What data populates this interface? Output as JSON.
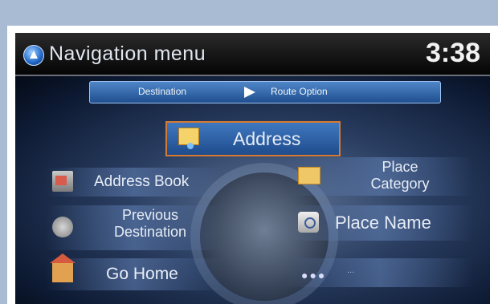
{
  "header": {
    "title": "Navigation menu",
    "clock": "3:38"
  },
  "tabs": {
    "destination": "Destination",
    "route_options": "Route Option"
  },
  "buttons": {
    "address": "Address",
    "address_book": "Address Book",
    "previous_destination_line1": "Previous",
    "previous_destination_line2": "Destination",
    "go_home": "Go Home",
    "place_category_line1": "Place",
    "place_category_line2": "Category",
    "place_name": "Place Name",
    "more_label": "..."
  },
  "colors": {
    "background": "#a9bad3",
    "accent": "#d57a32"
  },
  "icons": {
    "title": "navigation-icon",
    "address": "map-icon",
    "address_book": "address-book-icon",
    "previous_destination": "history-icon",
    "go_home": "home-icon",
    "place_category": "folder-icon",
    "place_name": "search-icon",
    "more": "more-dots-icon"
  }
}
